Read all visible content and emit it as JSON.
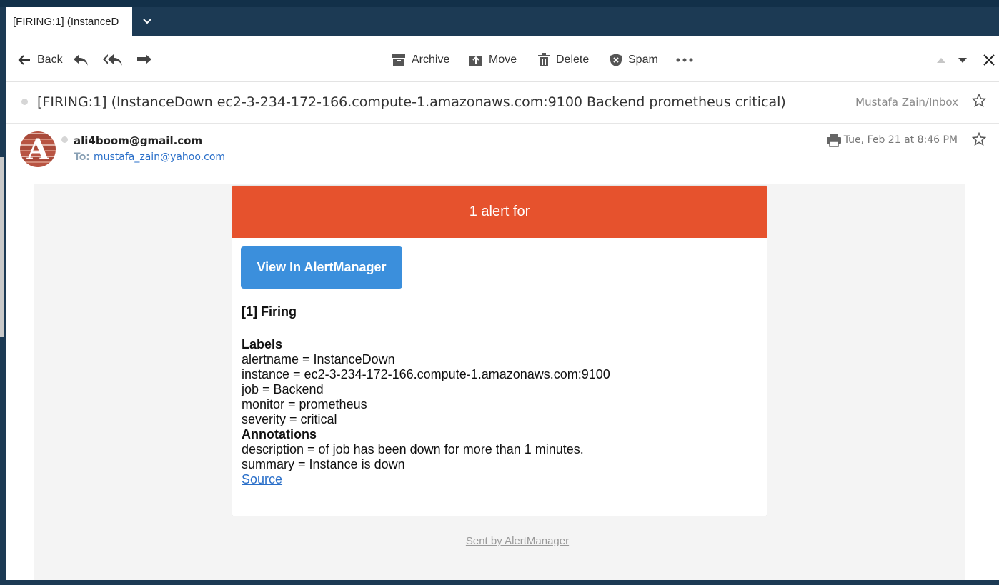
{
  "tab": {
    "title": "[FIRING:1] (InstanceD"
  },
  "toolbar": {
    "back_label": "Back",
    "archive_label": "Archive",
    "move_label": "Move",
    "delete_label": "Delete",
    "spam_label": "Spam"
  },
  "message": {
    "subject": "[FIRING:1] (InstanceDown ec2-3-234-172-166.compute-1.amazonaws.com:9100 Backend prometheus critical)",
    "folder": "Mustafa Zain/Inbox",
    "sender": "ali4boom@gmail.com",
    "to_label": "To:",
    "to_address": "mustafa_zain@yahoo.com",
    "date": "Tue, Feb 21 at 8:46 PM",
    "avatar_letter": "A"
  },
  "email": {
    "banner": "1 alert for",
    "button": "View In AlertManager",
    "firing_heading": "[1] Firing",
    "labels_heading": "Labels",
    "labels": [
      "alertname = InstanceDown",
      "instance = ec2-3-234-172-166.compute-1.amazonaws.com:9100",
      "job = Backend",
      "monitor = prometheus",
      "severity = critical"
    ],
    "annotations_heading": "Annotations",
    "annotations": [
      "description = of job has been down for more than 1 minutes.",
      "summary = Instance is down"
    ],
    "source_link": "Source",
    "footer": "Sent by AlertManager"
  },
  "colors": {
    "banner": "#e6522d",
    "button": "#3b8fdc",
    "titlebar": "#1c3a54",
    "link": "#2a6fc9"
  }
}
